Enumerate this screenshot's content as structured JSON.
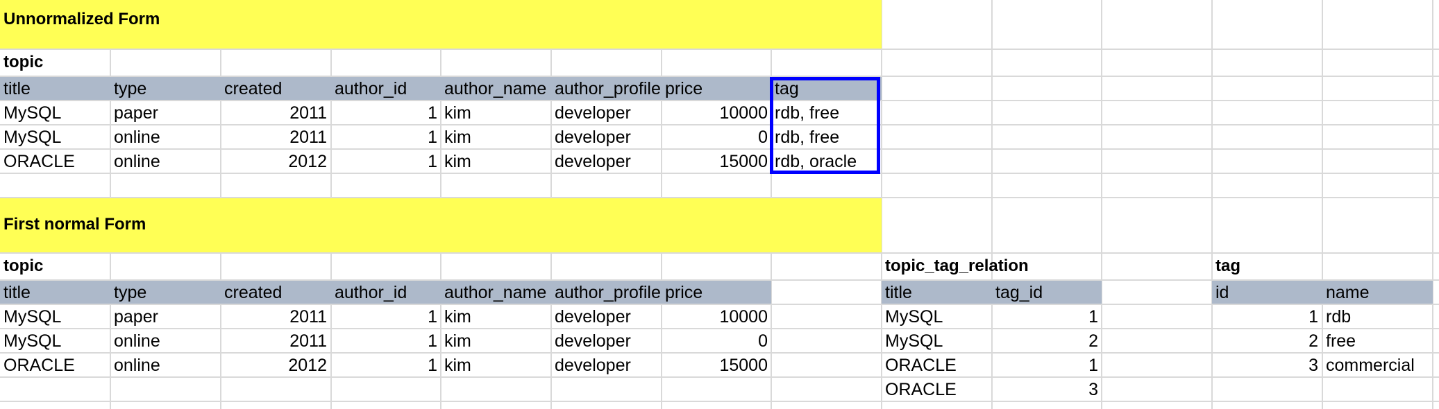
{
  "unnormalized": {
    "banner": "Unnormalized Form",
    "table_name": "topic",
    "columns": [
      "title",
      "type",
      "created",
      "author_id",
      "author_name",
      "author_profile",
      "price",
      "tag"
    ],
    "rows": [
      [
        "MySQL",
        "paper",
        "2011",
        "1",
        "kim",
        "developer",
        "10000",
        "rdb, free"
      ],
      [
        "MySQL",
        "online",
        "2011",
        "1",
        "kim",
        "developer",
        "0",
        "rdb, free"
      ],
      [
        "ORACLE",
        "online",
        "2012",
        "1",
        "kim",
        "developer",
        "15000",
        "rdb, oracle"
      ]
    ],
    "highlight_color": "#0000ff"
  },
  "first_normal": {
    "banner": "First normal Form",
    "topic": {
      "table_name": "topic",
      "columns": [
        "title",
        "type",
        "created",
        "author_id",
        "author_name",
        "author_profile",
        "price"
      ],
      "rows": [
        [
          "MySQL",
          "paper",
          "2011",
          "1",
          "kim",
          "developer",
          "10000"
        ],
        [
          "MySQL",
          "online",
          "2011",
          "1",
          "kim",
          "developer",
          "0"
        ],
        [
          "ORACLE",
          "online",
          "2012",
          "1",
          "kim",
          "developer",
          "15000"
        ]
      ]
    },
    "relation": {
      "table_name": "topic_tag_relation",
      "columns": [
        "title",
        "tag_id"
      ],
      "rows": [
        [
          "MySQL",
          "1"
        ],
        [
          "MySQL",
          "2"
        ],
        [
          "ORACLE",
          "1"
        ],
        [
          "ORACLE",
          "3"
        ]
      ]
    },
    "tag": {
      "table_name": "tag",
      "columns": [
        "id",
        "name"
      ],
      "rows": [
        [
          "1",
          "rdb"
        ],
        [
          "2",
          "free"
        ],
        [
          "3",
          "commercial"
        ]
      ]
    }
  },
  "colors": {
    "banner": "#ffff55",
    "header": "#adb9ca",
    "gridline": "#d9d9d9"
  }
}
